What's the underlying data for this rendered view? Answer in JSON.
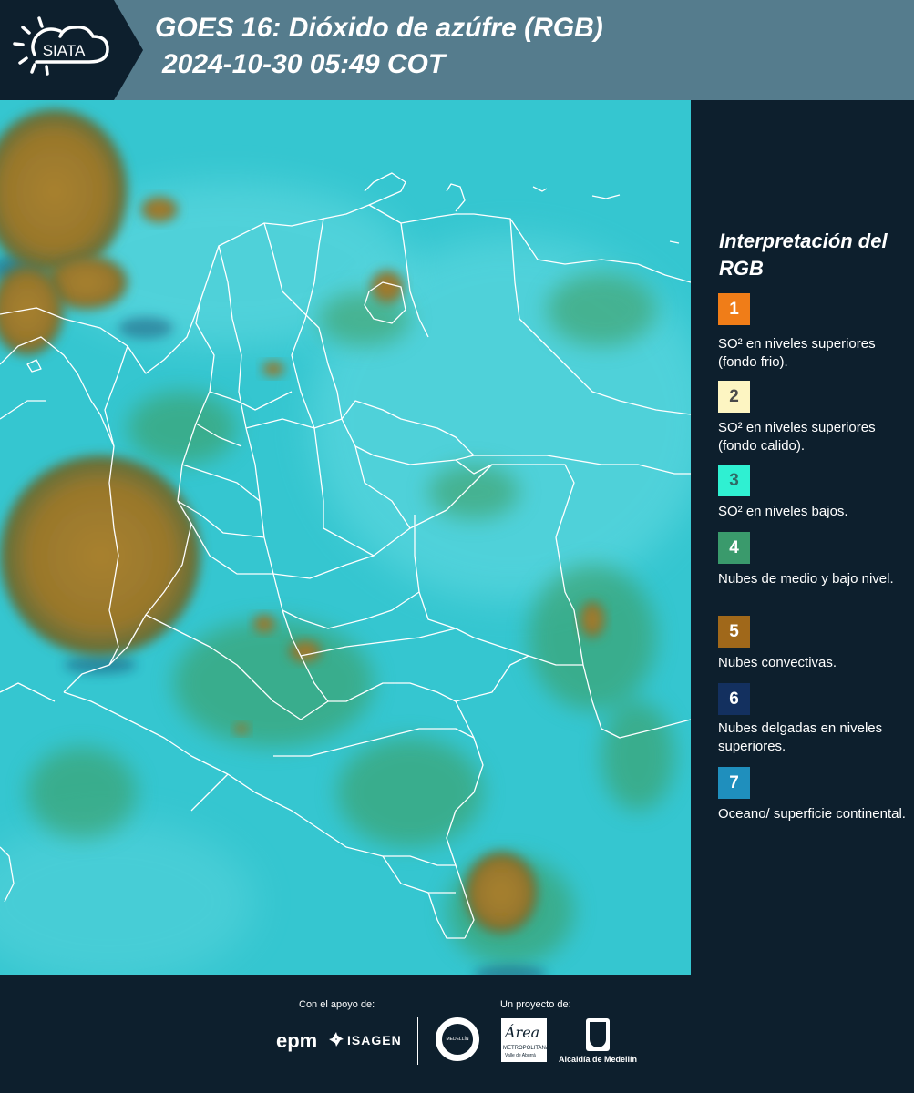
{
  "header": {
    "logo_text": "SIATA",
    "title_line1": "GOES 16: Dióxido de azúfre (RGB)",
    "title_line2": "2024-10-30 05:49 COT"
  },
  "map": {
    "background_color": "#35c6d0",
    "cloud_color": "#a07b2c",
    "low_cloud_color": "#3e9a58",
    "border_color": "#ffffff"
  },
  "legend": {
    "title": "Interpretación del RGB",
    "items": [
      {
        "number": "1",
        "color": "#f07d18",
        "number_color": "#ffffff",
        "text": "SO² en niveles superiores (fondo frio)."
      },
      {
        "number": "2",
        "color": "#fdf5c2",
        "number_color": "#4a4a4a",
        "text": "SO² en niveles superiores (fondo calido)."
      },
      {
        "number": "3",
        "color": "#2ff0d2",
        "number_color": "#2f6b66",
        "text": "SO² en niveles bajos."
      },
      {
        "number": "4",
        "color": "#3a9a6c",
        "number_color": "#ffffff",
        "text": "Nubes de medio y bajo nivel."
      },
      {
        "number": "5",
        "color": "#a0681a",
        "number_color": "#ffffff",
        "text": "Nubes convectivas."
      },
      {
        "number": "6",
        "color": "#13305f",
        "number_color": "#ffffff",
        "text": "Nubes delgadas en niveles superiores."
      },
      {
        "number": "7",
        "color": "#1f8fbd",
        "number_color": "#ffffff",
        "text": "Oceano/ superficie continental."
      }
    ]
  },
  "footer": {
    "support_label": "Con el apoyo de:",
    "project_label": "Un proyecto de:",
    "epm_text": "epm",
    "isagen_text": "ISAGEN",
    "medellin_seal_text": "MEDELLÍN",
    "area_text": "Área",
    "area_subtitle": "METROPOLITANA",
    "area_subtitle2": "Valle de Aburrá",
    "alcaldia_text": "Alcaldía de Medellín"
  }
}
